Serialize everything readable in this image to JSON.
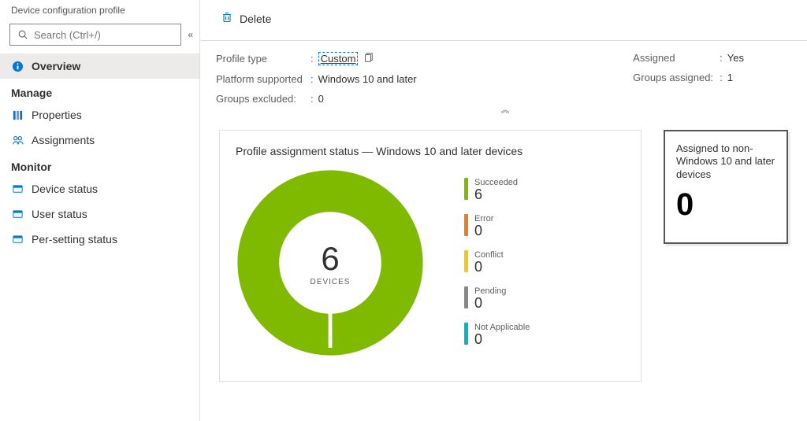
{
  "sidebar": {
    "header": "Device configuration profile",
    "search_placeholder": "Search (Ctrl+/)",
    "overview_label": "Overview",
    "sections": {
      "manage": "Manage",
      "monitor": "Monitor"
    },
    "manage_items": [
      {
        "label": "Properties"
      },
      {
        "label": "Assignments"
      }
    ],
    "monitor_items": [
      {
        "label": "Device status"
      },
      {
        "label": "User status"
      },
      {
        "label": "Per-setting status"
      }
    ]
  },
  "toolbar": {
    "delete_label": "Delete"
  },
  "info": {
    "left": {
      "profile_type_label": "Profile type",
      "profile_type_value": "Custom",
      "platform_label": "Platform supported",
      "platform_value": "Windows 10 and later",
      "groups_excluded_label": "Groups excluded:",
      "groups_excluded_value": "0"
    },
    "right": {
      "assigned_label": "Assigned",
      "assigned_value": "Yes",
      "groups_assigned_label": "Groups assigned:",
      "groups_assigned_value": "1"
    }
  },
  "status_card": {
    "title": "Profile assignment status — Windows 10 and later devices",
    "center_number": "6",
    "center_label": "DEVICES"
  },
  "chart_data": {
    "type": "pie",
    "title": "Profile assignment status — Windows 10 and later devices",
    "total": 6,
    "total_label": "DEVICES",
    "series": [
      {
        "name": "Succeeded",
        "value": 6,
        "color": "#7fba00"
      },
      {
        "name": "Error",
        "value": 0,
        "color": "#e67e22"
      },
      {
        "name": "Conflict",
        "value": 0,
        "color": "#f2c811"
      },
      {
        "name": "Pending",
        "value": 0,
        "color": "#8a8886"
      },
      {
        "name": "Not Applicable",
        "value": 0,
        "color": "#00b7c3"
      }
    ]
  },
  "side_card": {
    "text": "Assigned to non-Windows 10 and later devices",
    "value": "0"
  }
}
